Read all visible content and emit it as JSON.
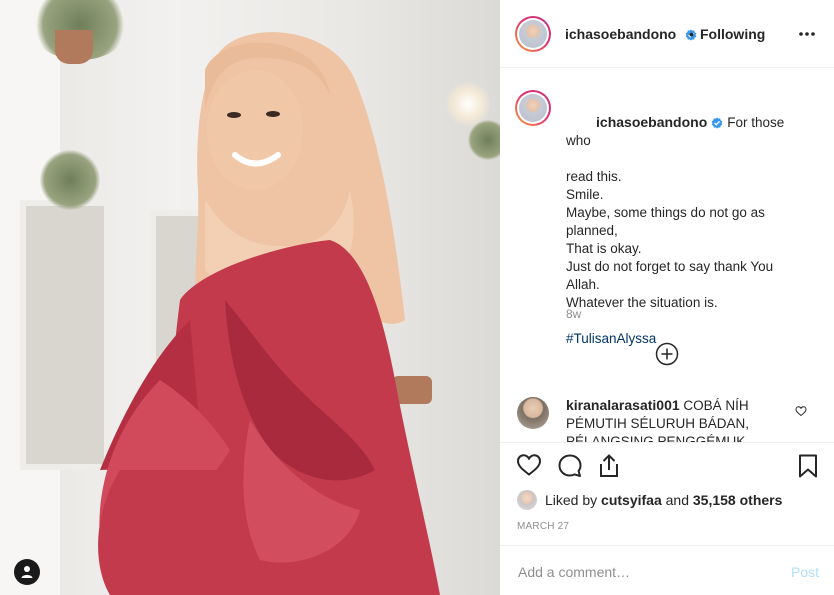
{
  "post": {
    "username": "ichasoebandono",
    "verified": true,
    "follow_separator": "•",
    "follow_state": "Following",
    "more_icon": "more-horizontal-icon",
    "caption_lines": [
      "For those who",
      "read this.",
      "Smile.",
      "Maybe, some things do not go as",
      "planned,",
      "That is okay.",
      "Just do not forget to say thank You",
      "Allah.",
      "Whatever the situation is."
    ],
    "hashtag": "#TulisanAlyssa",
    "age": "8w",
    "load_more_icon": "plus-circle-icon"
  },
  "comment": {
    "username": "kiranalarasati001",
    "text_lines": [
      "COBÁ NÍH",
      "PÉMUTIH SÉLURUH BÁDAN,",
      "PÉLANGSING PENGGÉMUK PÉNIN"
    ]
  },
  "actions": {
    "icons": [
      "heart-icon",
      "comment-icon",
      "share-icon",
      "bookmark-icon"
    ]
  },
  "likes": {
    "prefix": "Liked by",
    "user": "cutsyifaa",
    "connector": "and",
    "others": "35,158 others"
  },
  "date": "MARCH 27",
  "add_comment": {
    "placeholder": "Add a comment…",
    "post_label": "Post"
  },
  "colors": {
    "text": "#262626",
    "muted": "#8e8e8e",
    "link": "#003569",
    "verified": "#3897f0",
    "post_disabled": "#b2dffc",
    "dress": "#c23a4c",
    "hijab": "#efc4a4"
  }
}
